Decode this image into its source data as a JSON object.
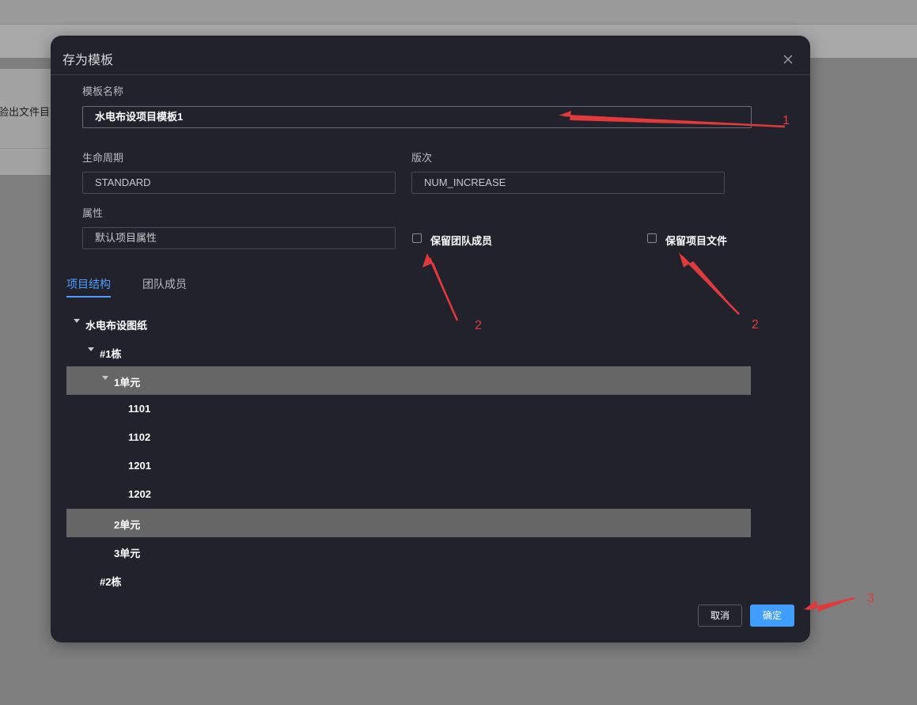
{
  "background": {
    "panel_text": "验出文件目"
  },
  "dialog": {
    "title": "存为模板",
    "close_icon": "close-icon"
  },
  "form": {
    "template_name_label": "模板名称",
    "template_name_value": "水电布设项目模板1",
    "lifecycle_label": "生命周期",
    "lifecycle_value": "STANDARD",
    "version_label": "版次",
    "version_value": "NUM_INCREASE",
    "attribute_label": "属性",
    "attribute_value": "默认项目属性",
    "keep_members_label": "保留团队成员",
    "keep_members_checked": false,
    "keep_files_label": "保留项目文件",
    "keep_files_checked": false
  },
  "tabs": [
    {
      "label": "项目结构",
      "active": true
    },
    {
      "label": "团队成员",
      "active": false
    }
  ],
  "tree": [
    {
      "label": "水电布设图纸",
      "level": 0,
      "expanded": true,
      "selected": false
    },
    {
      "label": "#1栋",
      "level": 1,
      "expanded": true,
      "selected": false
    },
    {
      "label": "1单元",
      "level": 2,
      "expanded": true,
      "selected": true
    },
    {
      "label": "1101",
      "level": 3,
      "selected": false
    },
    {
      "label": "1102",
      "level": 3,
      "selected": false
    },
    {
      "label": "1201",
      "level": 3,
      "selected": false
    },
    {
      "label": "1202",
      "level": 3,
      "selected": false
    },
    {
      "label": "2单元",
      "level": 2,
      "selected": true
    },
    {
      "label": "3单元",
      "level": 2,
      "selected": false
    },
    {
      "label": "#2栋",
      "level": 1,
      "selected": false
    }
  ],
  "footer": {
    "cancel_label": "取消",
    "ok_label": "确定"
  },
  "annotations": {
    "color": "#e23a3a",
    "labels": [
      "1",
      "2",
      "2",
      "3"
    ]
  },
  "colors": {
    "accent": "#409eff",
    "tab_active": "#4a9eff",
    "dialog_bg": "#22222d",
    "selected_row": "#666666"
  }
}
